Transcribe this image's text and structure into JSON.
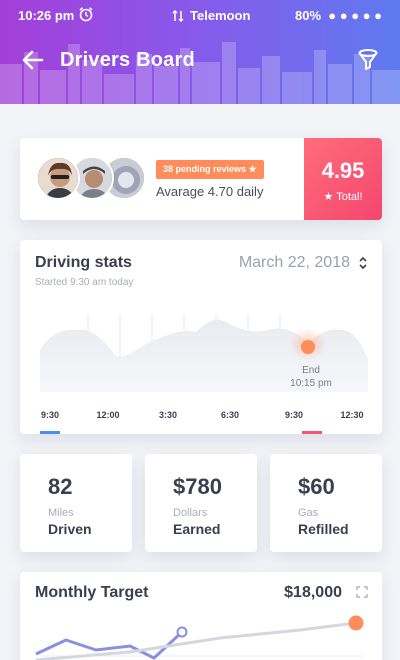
{
  "status_bar": {
    "time": "10:26 pm",
    "carrier": "Telemoon",
    "battery": "80%"
  },
  "header": {
    "title": "Drivers Board"
  },
  "reviews": {
    "badge": "38 pending reviews ★",
    "average_text": "Avarage 4.70 daily",
    "total_score": "4.95",
    "total_label": "★ Total!"
  },
  "driving_stats": {
    "title": "Driving stats",
    "date": "March 22, 2018",
    "subtitle": "Started 9:30 am today",
    "end_label": "End",
    "end_time": "10:15 pm",
    "ticks": [
      "9:30",
      "12:00",
      "3:30",
      "6:30",
      "9:30",
      "12:30"
    ]
  },
  "summary": [
    {
      "value": "82",
      "unit": "Miles",
      "label": "Driven"
    },
    {
      "value": "$780",
      "unit": "Dollars",
      "label": "Earned"
    },
    {
      "value": "$60",
      "unit": "Gas",
      "label": "Refilled"
    }
  ],
  "monthly_target": {
    "title": "Monthly Target",
    "amount": "$18,000"
  },
  "colors": {
    "header_start": "#a33fd8",
    "header_end": "#5f7af0",
    "accent_orange": "#ff8c5a",
    "total_red": "#f4466f",
    "marker_blue": "#4a8ef0",
    "marker_red": "#f4566f"
  }
}
